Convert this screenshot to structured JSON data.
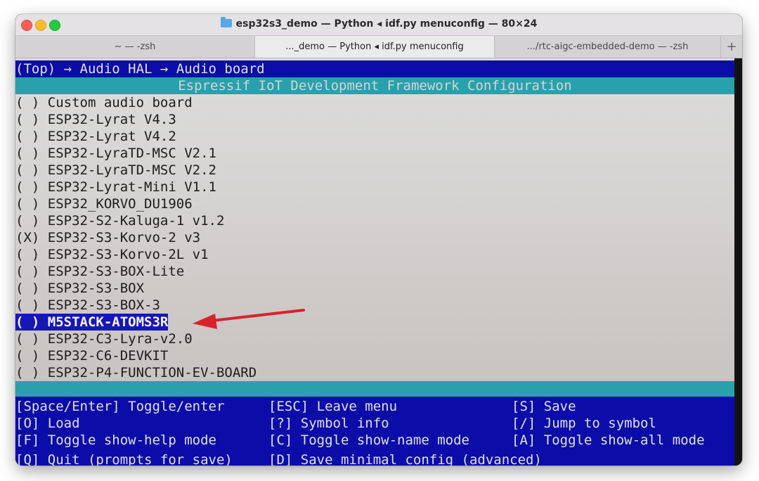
{
  "window": {
    "title": "esp32s3_demo — Python ◂ idf.py menuconfig — 80×24"
  },
  "tabs": [
    {
      "label": "~ — -zsh"
    },
    {
      "label": "..._demo — Python ◂ idf.py menuconfig"
    },
    {
      "label": ".../rtc-aigc-embedded-demo — -zsh"
    }
  ],
  "tab_add_label": "+",
  "menu": {
    "breadcrumb": "(Top) → Audio HAL → Audio board",
    "header": "Espressif IoT Development Framework Configuration",
    "items": [
      {
        "label": "( ) Custom audio board",
        "selected": false
      },
      {
        "label": "( ) ESP32-Lyrat V4.3",
        "selected": false
      },
      {
        "label": "( ) ESP32-Lyrat V4.2",
        "selected": false
      },
      {
        "label": "( ) ESP32-LyraTD-MSC V2.1",
        "selected": false
      },
      {
        "label": "( ) ESP32-LyraTD-MSC V2.2",
        "selected": false
      },
      {
        "label": "( ) ESP32-Lyrat-Mini V1.1",
        "selected": false
      },
      {
        "label": "( ) ESP32_KORVO_DU1906",
        "selected": false
      },
      {
        "label": "( ) ESP32-S2-Kaluga-1 v1.2",
        "selected": false
      },
      {
        "label": "(X) ESP32-S3-Korvo-2 v3",
        "selected": false
      },
      {
        "label": "( ) ESP32-S3-Korvo-2L v1",
        "selected": false
      },
      {
        "label": "( ) ESP32-S3-BOX-Lite",
        "selected": false
      },
      {
        "label": "( ) ESP32-S3-BOX",
        "selected": false
      },
      {
        "label": "( ) ESP32-S3-BOX-3",
        "selected": false
      },
      {
        "label": "( ) M5STACK-ATOMS3R",
        "selected": true
      },
      {
        "label": "( ) ESP32-C3-Lyra-v2.0",
        "selected": false
      },
      {
        "label": "( ) ESP32-C6-DEVKIT",
        "selected": false
      },
      {
        "label": "( ) ESP32-P4-FUNCTION-EV-BOARD",
        "selected": false
      }
    ]
  },
  "help": {
    "rows": [
      {
        "c1": "[Space/Enter] Toggle/enter",
        "c2": "[ESC] Leave menu",
        "c3": "[S] Save"
      },
      {
        "c1": "[O] Load",
        "c2": "[?] Symbol info",
        "c3": "[/] Jump to symbol"
      },
      {
        "c1": "[F] Toggle show-help mode",
        "c2": "[C] Toggle show-name mode",
        "c3": "[A] Toggle show-all mode"
      },
      {
        "c1": "[Q] Quit (prompts for save)",
        "c2": "[D] Save minimal config (advanced)",
        "c3": ""
      }
    ]
  },
  "colors": {
    "menu_blue": "#0c0ca8",
    "header_cyan": "#2aa0ad",
    "selection_blue": "#1717b3",
    "annotation_arrow": "#d8232a"
  },
  "icons": [
    "folder-icon",
    "annotation-arrow"
  ]
}
